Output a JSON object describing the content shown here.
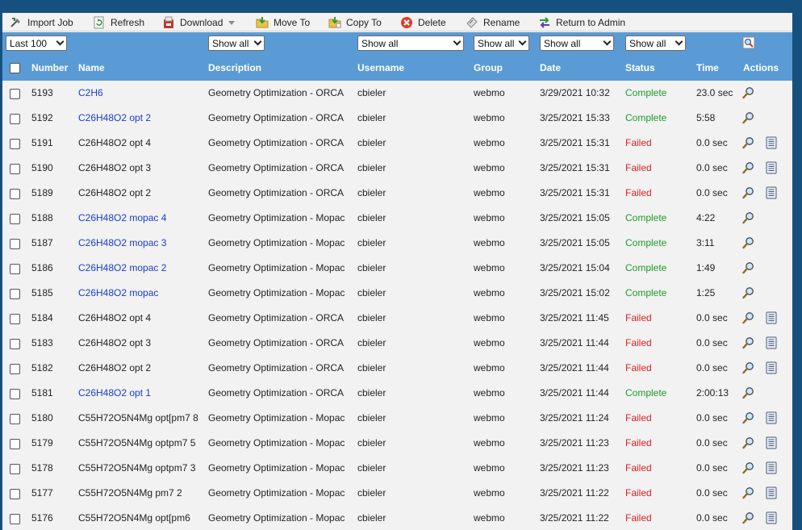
{
  "toolbar": {
    "import_job": "Import Job",
    "refresh": "Refresh",
    "download": "Download",
    "move_to": "Move To",
    "copy_to": "Copy To",
    "delete": "Delete",
    "rename": "Rename",
    "return_to_admin": "Return to Admin"
  },
  "filters": {
    "limit": "Last 100",
    "description": "Show all",
    "username": "Show all",
    "group": "Show all",
    "date": "Show all",
    "status": "Show all"
  },
  "columns": {
    "number": "Number",
    "name": "Name",
    "description": "Description",
    "username": "Username",
    "group": "Group",
    "date": "Date",
    "status": "Status",
    "time": "Time",
    "actions": "Actions"
  },
  "colors": {
    "complete": "#1d9c2a",
    "failed": "#e02020",
    "link": "#1a3cc9",
    "header": "#5b9bd5"
  },
  "jobs": [
    {
      "number": "5193",
      "name": "C2H6",
      "link": true,
      "description": "Geometry Optimization - ORCA",
      "username": "cbieler",
      "group": "webmo",
      "date": "3/29/2021 10:32",
      "status": "Complete",
      "time": "23.0 sec",
      "log": false
    },
    {
      "number": "5192",
      "name": "C26H48O2 opt 2",
      "link": true,
      "description": "Geometry Optimization - ORCA",
      "username": "cbieler",
      "group": "webmo",
      "date": "3/25/2021 15:33",
      "status": "Complete",
      "time": "5:58",
      "log": false
    },
    {
      "number": "5191",
      "name": "C26H48O2 opt 4",
      "link": false,
      "description": "Geometry Optimization - ORCA",
      "username": "cbieler",
      "group": "webmo",
      "date": "3/25/2021 15:31",
      "status": "Failed",
      "time": "0.0 sec",
      "log": true
    },
    {
      "number": "5190",
      "name": "C26H48O2 opt 3",
      "link": false,
      "description": "Geometry Optimization - ORCA",
      "username": "cbieler",
      "group": "webmo",
      "date": "3/25/2021 15:31",
      "status": "Failed",
      "time": "0.0 sec",
      "log": true
    },
    {
      "number": "5189",
      "name": "C26H48O2 opt 2",
      "link": false,
      "description": "Geometry Optimization - ORCA",
      "username": "cbieler",
      "group": "webmo",
      "date": "3/25/2021 15:31",
      "status": "Failed",
      "time": "0.0 sec",
      "log": true
    },
    {
      "number": "5188",
      "name": "C26H48O2 mopac 4",
      "link": true,
      "description": "Geometry Optimization - Mopac",
      "username": "cbieler",
      "group": "webmo",
      "date": "3/25/2021 15:05",
      "status": "Complete",
      "time": "4:22",
      "log": false
    },
    {
      "number": "5187",
      "name": "C26H48O2 mopac 3",
      "link": true,
      "description": "Geometry Optimization - Mopac",
      "username": "cbieler",
      "group": "webmo",
      "date": "3/25/2021 15:05",
      "status": "Complete",
      "time": "3:11",
      "log": false
    },
    {
      "number": "5186",
      "name": "C26H48O2 mopac 2",
      "link": true,
      "description": "Geometry Optimization - Mopac",
      "username": "cbieler",
      "group": "webmo",
      "date": "3/25/2021 15:04",
      "status": "Complete",
      "time": "1:49",
      "log": false
    },
    {
      "number": "5185",
      "name": "C26H48O2 mopac",
      "link": true,
      "description": "Geometry Optimization - Mopac",
      "username": "cbieler",
      "group": "webmo",
      "date": "3/25/2021 15:02",
      "status": "Complete",
      "time": "1:25",
      "log": false
    },
    {
      "number": "5184",
      "name": "C26H48O2 opt 4",
      "link": false,
      "description": "Geometry Optimization - ORCA",
      "username": "cbieler",
      "group": "webmo",
      "date": "3/25/2021 11:45",
      "status": "Failed",
      "time": "0.0 sec",
      "log": true
    },
    {
      "number": "5183",
      "name": "C26H48O2 opt 3",
      "link": false,
      "description": "Geometry Optimization - ORCA",
      "username": "cbieler",
      "group": "webmo",
      "date": "3/25/2021 11:44",
      "status": "Failed",
      "time": "0.0 sec",
      "log": true
    },
    {
      "number": "5182",
      "name": "C26H48O2 opt 2",
      "link": false,
      "description": "Geometry Optimization - ORCA",
      "username": "cbieler",
      "group": "webmo",
      "date": "3/25/2021 11:44",
      "status": "Failed",
      "time": "0.0 sec",
      "log": true
    },
    {
      "number": "5181",
      "name": "C26H48O2 opt 1",
      "link": true,
      "description": "Geometry Optimization - ORCA",
      "username": "cbieler",
      "group": "webmo",
      "date": "3/25/2021 11:44",
      "status": "Complete",
      "time": "2:00:13",
      "log": false
    },
    {
      "number": "5180",
      "name": "C55H72O5N4Mg opt[pm7 8",
      "link": false,
      "description": "Geometry Optimization - Mopac",
      "username": "cbieler",
      "group": "webmo",
      "date": "3/25/2021 11:24",
      "status": "Failed",
      "time": "0.0 sec",
      "log": true
    },
    {
      "number": "5179",
      "name": "C55H72O5N4Mg optpm7 5",
      "link": false,
      "description": "Geometry Optimization - Mopac",
      "username": "cbieler",
      "group": "webmo",
      "date": "3/25/2021 11:23",
      "status": "Failed",
      "time": "0.0 sec",
      "log": true
    },
    {
      "number": "5178",
      "name": "C55H72O5N4Mg optpm7 3",
      "link": false,
      "description": "Geometry Optimization - Mopac",
      "username": "cbieler",
      "group": "webmo",
      "date": "3/25/2021 11:23",
      "status": "Failed",
      "time": "0.0 sec",
      "log": true
    },
    {
      "number": "5177",
      "name": "C55H72O5N4Mg pm7 2",
      "link": false,
      "description": "Geometry Optimization - Mopac",
      "username": "cbieler",
      "group": "webmo",
      "date": "3/25/2021 11:22",
      "status": "Failed",
      "time": "0.0 sec",
      "log": true
    },
    {
      "number": "5176",
      "name": "C55H72O5N4Mg opt[pm6",
      "link": false,
      "description": "Geometry Optimization - Mopac",
      "username": "cbieler",
      "group": "webmo",
      "date": "3/25/2021 11:22",
      "status": "Failed",
      "time": "0.0 sec",
      "log": true
    }
  ]
}
